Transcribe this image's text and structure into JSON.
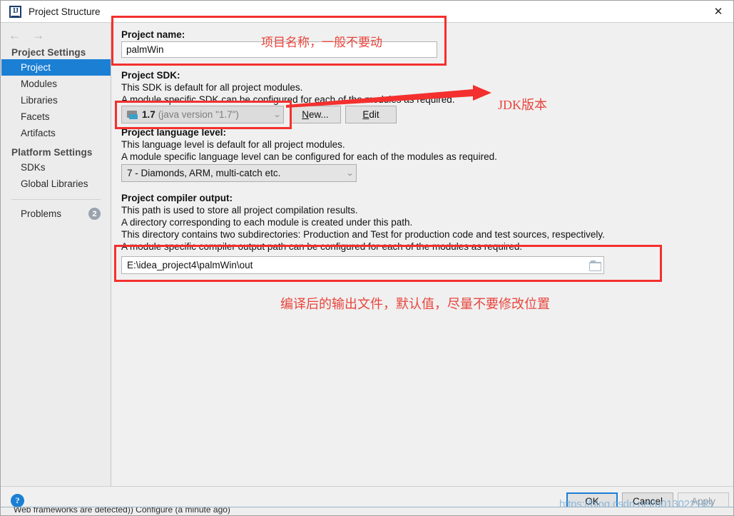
{
  "window": {
    "title": "Project Structure",
    "app_icon": "IJ",
    "close_label": "✕"
  },
  "nav": {
    "back_label": "←",
    "forward_label": "→"
  },
  "sidebar": {
    "groups": [
      {
        "header": "Project Settings",
        "items": [
          {
            "label": "Project",
            "selected": true
          },
          {
            "label": "Modules",
            "selected": false
          },
          {
            "label": "Libraries",
            "selected": false
          },
          {
            "label": "Facets",
            "selected": false
          },
          {
            "label": "Artifacts",
            "selected": false
          }
        ]
      },
      {
        "header": "Platform Settings",
        "items": [
          {
            "label": "SDKs",
            "selected": false
          },
          {
            "label": "Global Libraries",
            "selected": false
          }
        ]
      }
    ],
    "problems": {
      "label": "Problems",
      "count": "2"
    }
  },
  "main": {
    "project_name": {
      "label": "Project name:",
      "value": "palmWin"
    },
    "project_sdk": {
      "label": "Project SDK:",
      "desc_line1": "This SDK is default for all project modules.",
      "desc_line2": "A module specific SDK can be configured for each of the modules as required.",
      "selected_version": "1.7",
      "selected_detail": "(java version \"1.7\")",
      "new_button": "New...",
      "new_button_mnemonic": "N",
      "edit_button": "Edit",
      "edit_button_mnemonic": "E"
    },
    "language_level": {
      "label": "Project language level:",
      "desc_line1": "This language level is default for all project modules.",
      "desc_line2": "A module specific language level can be configured for each of the modules as required.",
      "selected": "7 - Diamonds, ARM, multi-catch etc."
    },
    "compiler_output": {
      "label": "Project compiler output:",
      "desc_line1": "This path is used to store all project compilation results.",
      "desc_line2": "A directory corresponding to each module is created under this path.",
      "desc_line3": "This directory contains two subdirectories: Production and Test for production code and test sources, respectively.",
      "desc_line4": "A module specific compiler output path can be configured for each of the modules as required.",
      "value": "E:\\idea_project4\\palmWin\\out"
    }
  },
  "annotations": {
    "project_name_note": "项目名称，一般不要动",
    "jdk_note": "JDK版本",
    "compiler_output_note": "编译后的输出文件，默认值，尽量不要修改位置",
    "highlight_color": "#f3302e",
    "text_color": "#e8453c"
  },
  "footer": {
    "help_label": "?",
    "ok_label": "OK",
    "cancel_label": "Cancel",
    "apply_label": "Apply"
  },
  "watermark": {
    "text": "https://blog.csdn.net/u013022183"
  },
  "status_bar": {
    "text": "Web frameworks are detected)) Configure (a minute ago)"
  }
}
